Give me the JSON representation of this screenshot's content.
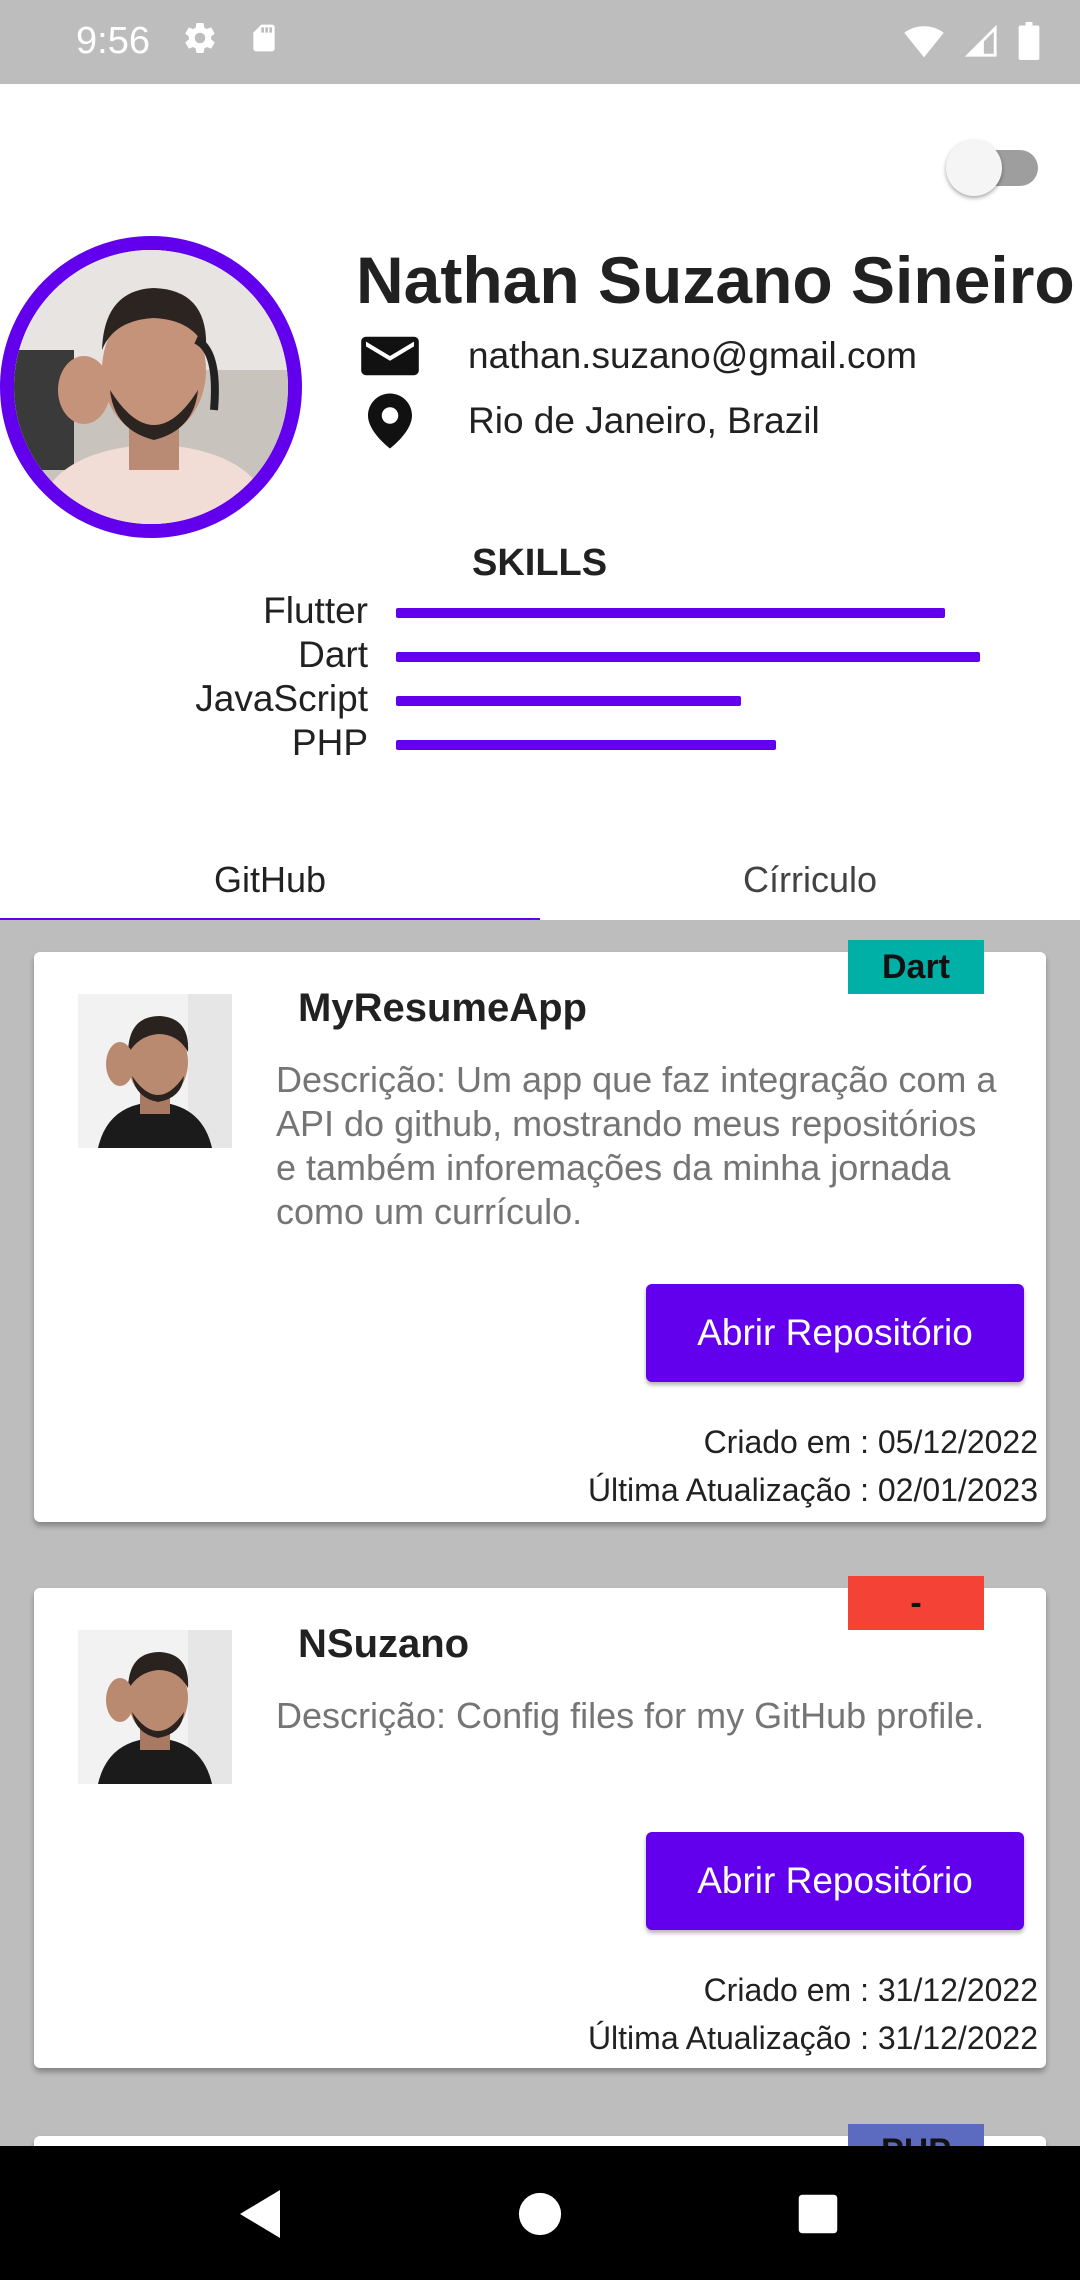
{
  "status_bar": {
    "time": "9:56"
  },
  "header": {
    "name": "Nathan Suzano Sineiro",
    "email": "nathan.suzano@gmail.com",
    "location": "Rio de Janeiro, Brazil",
    "theme_toggle_on": false,
    "skills_title": "SKILLS",
    "skills": [
      {
        "label": "Flutter",
        "level": 0.94
      },
      {
        "label": "Dart",
        "level": 1.0
      },
      {
        "label": "JavaScript",
        "level": 0.59
      },
      {
        "label": "PHP",
        "level": 0.65
      }
    ]
  },
  "tabs": [
    {
      "label": "GitHub",
      "selected": true
    },
    {
      "label": "Círriculo",
      "selected": false
    }
  ],
  "repos": [
    {
      "badge": "Dart",
      "badge_color": "#00b0a7",
      "title": "MyResumeApp",
      "description": "Descrição: Um app que faz integração com a API do github, mostrando meus repositórios e também inforemações da minha jornada como um currículo.",
      "button_label": "Abrir Repositório",
      "created": "Criado em : 05/12/2022",
      "updated": "Última Atualização : 02/01/2023"
    },
    {
      "badge": "-",
      "badge_color": "#f44336",
      "title": "NSuzano",
      "description": "Descrição: Config files for my GitHub profile.",
      "button_label": "Abrir Repositório",
      "created": "Criado em : 31/12/2022",
      "updated": "Última Atualização : 31/12/2022"
    },
    {
      "badge": "PHP",
      "badge_color": "#5c6bc0"
    }
  ],
  "colors": {
    "accent": "#6200ee",
    "list_bg": "#bdbdbd"
  }
}
